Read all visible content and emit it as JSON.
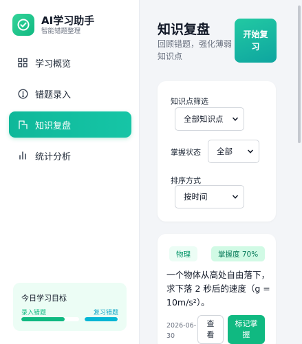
{
  "brand": {
    "title": "AI学习助手",
    "subtitle": "智能错题整理",
    "logo_icon": "check-circle-icon"
  },
  "nav": [
    {
      "label": "学习概览",
      "icon": "grid-icon",
      "active": false
    },
    {
      "label": "错题录入",
      "icon": "alert-circle-icon",
      "active": false
    },
    {
      "label": "知识复盘",
      "icon": "review-icon",
      "active": true
    },
    {
      "label": "统计分析",
      "icon": "bar-chart-icon",
      "active": false
    }
  ],
  "goal": {
    "title": "今日学习目标",
    "left_label": "录入错题",
    "right_label": "复习错题",
    "left_progress": 0.75,
    "right_progress": 0.95
  },
  "header": {
    "title": "知识复盘",
    "description": "回顾错题，强化薄弱知识点",
    "start_button": "开始复习"
  },
  "filters": {
    "knowledge_label": "知识点筛选",
    "knowledge_value": "全部知识点",
    "mastery_label": "掌握状态",
    "mastery_value": "全部",
    "sort_label": "排序方式",
    "sort_value": "按时间"
  },
  "question": {
    "subject": "物理",
    "mastery": "掌握度 70%",
    "text": "一个物体从高处自由落下，求下落 2 秒后的速度（g = 10m/s²）。",
    "date": "2026-06-30",
    "view_button": "查看",
    "mark_button": "标记掌握"
  },
  "colors": {
    "accent": "#10b981",
    "accent_cyan": "#06b6d4"
  }
}
